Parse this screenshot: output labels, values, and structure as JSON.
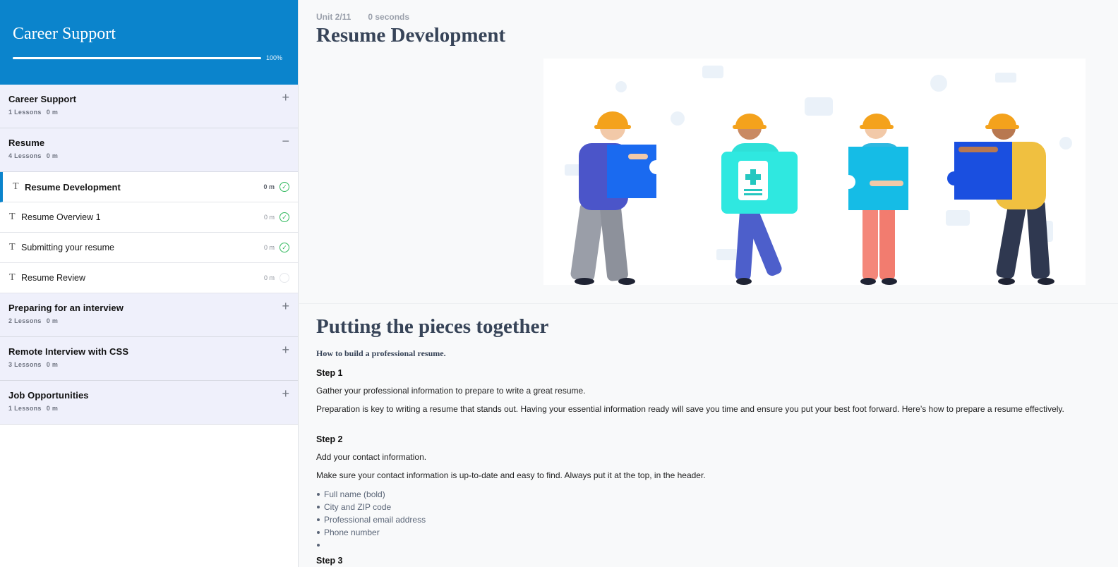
{
  "course": {
    "title": "Career Support",
    "progress_label": "100%",
    "progress_fraction": 1.0
  },
  "sections": [
    {
      "title": "Career Support",
      "lessons_label": "1 Lessons",
      "duration": "0 m",
      "toggle": "+"
    },
    {
      "title": "Resume",
      "lessons_label": "4 Lessons",
      "duration": "0 m",
      "toggle": "−"
    },
    {
      "title": "Preparing for an interview",
      "lessons_label": "2 Lessons",
      "duration": "0 m",
      "toggle": "+"
    },
    {
      "title": "Remote Interview with CSS",
      "lessons_label": "3 Lessons",
      "duration": "0 m",
      "toggle": "+"
    },
    {
      "title": "Job Opportunities",
      "lessons_label": "1 Lessons",
      "duration": "0 m",
      "toggle": "+"
    }
  ],
  "lessons": [
    {
      "type_glyph": "T",
      "title": "Resume Development",
      "duration": "0 m",
      "complete": true,
      "active": true
    },
    {
      "type_glyph": "T",
      "title": "Resume Overview 1",
      "duration": "0 m",
      "complete": true,
      "active": false
    },
    {
      "type_glyph": "T",
      "title": "Submitting your resume",
      "duration": "0 m",
      "complete": true,
      "active": false
    },
    {
      "type_glyph": "T",
      "title": "Resume Review",
      "duration": "0 m",
      "complete": false,
      "active": false
    }
  ],
  "main": {
    "unit": "Unit 2/11",
    "timer": "0 seconds",
    "title": "Resume Development",
    "hero_image_icon": "puzzle-team-illustration",
    "heading": "Putting the pieces together",
    "subtitle": "How to build a professional resume.",
    "step1_label": "Step 1",
    "step1_p1": "Gather your professional information to prepare to write a great resume.",
    "step1_p2": "Preparation is key to writing a resume that stands out. Having your essential information ready will save you time and ensure you put your best foot forward. Here’s how to prepare a resume effectively.",
    "step2_label": "Step 2",
    "step2_p1": "Add your contact information.",
    "step2_p2": "Make sure your contact information is up-to-date and easy to find. Always put it at the top, in the header.",
    "bullets": [
      "Full name (bold)",
      "City and ZIP code",
      "Professional email address",
      "Phone number",
      ""
    ],
    "step3_label": "Step 3"
  },
  "colors": {
    "brand": "#0b84cc",
    "complete": "#2fb85c",
    "heading": "#374458"
  }
}
